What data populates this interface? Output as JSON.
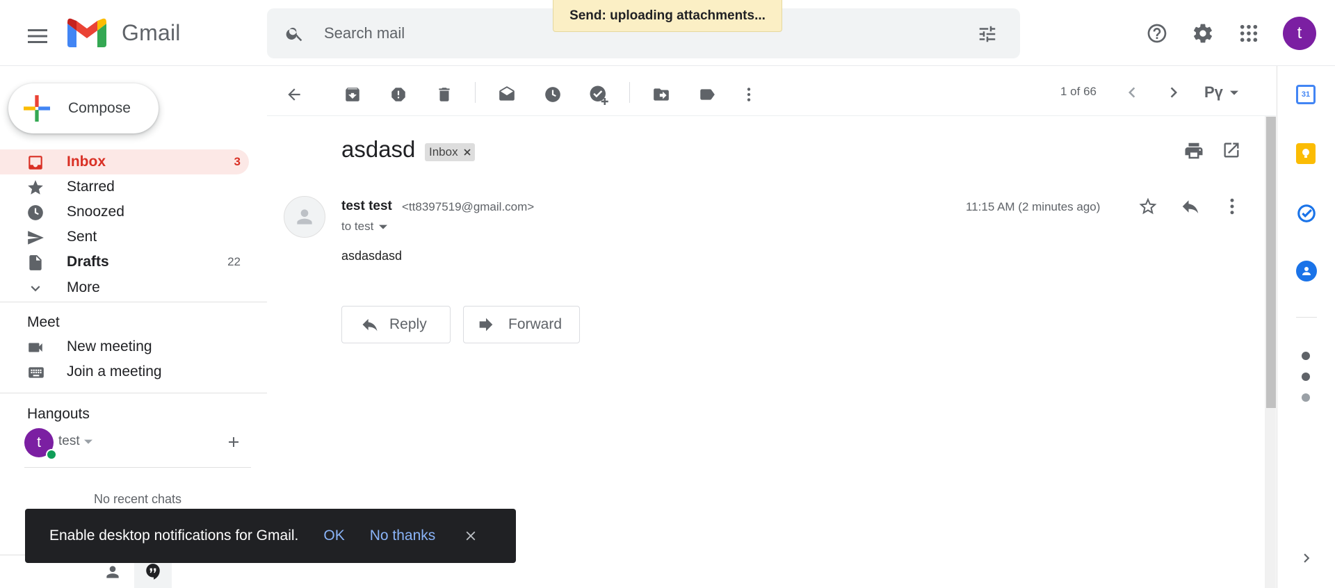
{
  "header": {
    "app_name": "Gmail",
    "search_placeholder": "Search mail",
    "status_toast": "Send: uploading attachments...",
    "avatar_letter": "t"
  },
  "sidebar": {
    "compose_label": "Compose",
    "items": [
      {
        "label": "Inbox",
        "count": "3",
        "icon": "inbox-icon"
      },
      {
        "label": "Starred",
        "count": "",
        "icon": "star-icon"
      },
      {
        "label": "Snoozed",
        "count": "",
        "icon": "clock-icon"
      },
      {
        "label": "Sent",
        "count": "",
        "icon": "send-icon"
      },
      {
        "label": "Drafts",
        "count": "22",
        "icon": "draft-icon"
      },
      {
        "label": "More",
        "count": "",
        "icon": "chevron-down-icon"
      }
    ],
    "meet": {
      "title": "Meet",
      "new_meeting": "New meeting",
      "join_meeting": "Join a meeting"
    },
    "hangouts": {
      "title": "Hangouts",
      "user_letter": "t",
      "user_name": "test",
      "no_chats": "No recent chats"
    }
  },
  "toolbar": {
    "pagination": "1 of 66",
    "input_tool": "Рү"
  },
  "mail": {
    "subject": "asdasd",
    "label": "Inbox",
    "sender_name": "test test",
    "sender_email": "<tt8397519@gmail.com>",
    "to": "to test",
    "time": "11:15 AM (2 minutes ago)",
    "body": "asdasdasd",
    "reply_label": "Reply",
    "forward_label": "Forward"
  },
  "notification": {
    "text": "Enable desktop notifications for Gmail.",
    "ok": "OK",
    "no_thanks": "No thanks"
  },
  "side_panel": {
    "calendar_day": "31"
  },
  "colors": {
    "inbox_active_bg": "#fce8e6",
    "inbox_active_text": "#d93025",
    "avatar": "#7b1fa2",
    "toast_bg": "#fbefc5",
    "snackbar_bg": "#202124",
    "snackbar_link": "#8ab4f8"
  }
}
